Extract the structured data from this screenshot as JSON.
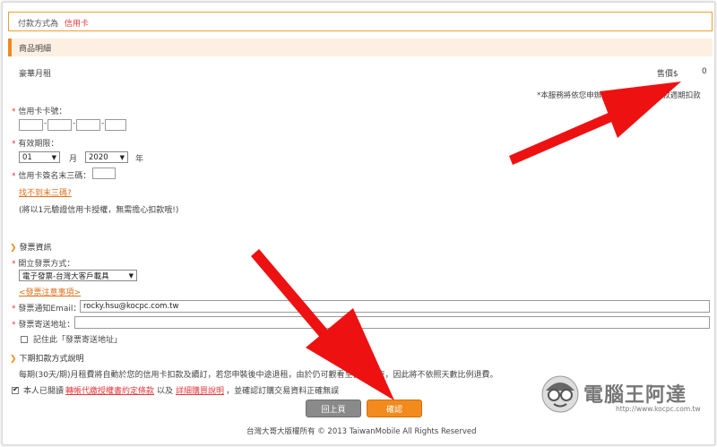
{
  "payment_method": {
    "label": "付款方式為",
    "value": "信用卡"
  },
  "product_section": {
    "title": "商品明細"
  },
  "product": {
    "name": "豪華月租",
    "price_label": "售價$",
    "price_value": "0",
    "notice": "*本服務將依您申辦的資費，於每期扣款週期扣款"
  },
  "card": {
    "number_label": "信用卡卡號：",
    "expiry_label": "有效期限：",
    "month_value": "01",
    "month_unit": "月",
    "year_value": "2020",
    "year_unit": "年",
    "cvv_label": "信用卡簽名末三碼：",
    "cvv_help_link": "找不到末三碼?",
    "verify_note": "(將以1元驗證信用卡授權，無需擔心扣款哦!)"
  },
  "invoice": {
    "section_title": "發票資訊",
    "type_label": "開立發票方式：",
    "type_value": "電子發票-台灣大客戶載具",
    "notes_link": "<發票注意事項>",
    "email_label": "發票通知Email：",
    "email_value": "rocky.hsu@kocpc.com.tw",
    "address_label": "發票寄送地址：",
    "remember_label": "記住此「發票寄送地址」"
  },
  "billing": {
    "section_title": "下期扣款方式說明",
    "description": "每期(30天/期)月租費將自動於您的信用卡扣款及續訂，若您申裝後中途退租，由於仍可觀看至當期結束，因此將不依照天數比例退費。"
  },
  "agreement": {
    "prefix": "本人已閱讀",
    "link1": "轉帳代繳授權書約定條款",
    "middle": "以及",
    "link2": "詳細購買說明",
    "suffix": "，並確認訂購交易資料正確無誤"
  },
  "buttons": {
    "back": "回上頁",
    "confirm": "確認"
  },
  "footer": {
    "copyright": "台灣大哥大版權所有 © 2013 TaiwanMobile All Rights Reserved"
  },
  "watermark": {
    "name": "電腦王阿達",
    "url": "http://www.kocpc.com.tw"
  },
  "colors": {
    "accent": "#f08a1c",
    "required": "#e4393c",
    "arrow": "#ee1111",
    "button_back": "#8a8a8a",
    "button_confirm": "#f28a1e"
  }
}
